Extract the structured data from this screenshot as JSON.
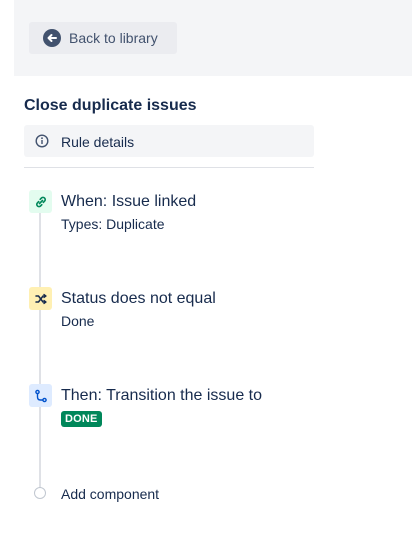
{
  "header": {
    "back_label": "Back to library"
  },
  "rule": {
    "title": "Close duplicate issues",
    "details_label": "Rule details"
  },
  "steps": [
    {
      "icon": "link-icon",
      "color": "#e3fcef",
      "title": "When: Issue linked",
      "subtitle": "Types: Duplicate"
    },
    {
      "icon": "shuffle-icon",
      "color": "#fff0b3",
      "title": "Status does not equal",
      "subtitle": "Done"
    },
    {
      "icon": "branch-icon",
      "color": "#deebff",
      "title": "Then: Transition the issue to",
      "status_lozenge": "DONE",
      "lozenge_color": "#00875a"
    }
  ],
  "add_component_label": "Add component"
}
